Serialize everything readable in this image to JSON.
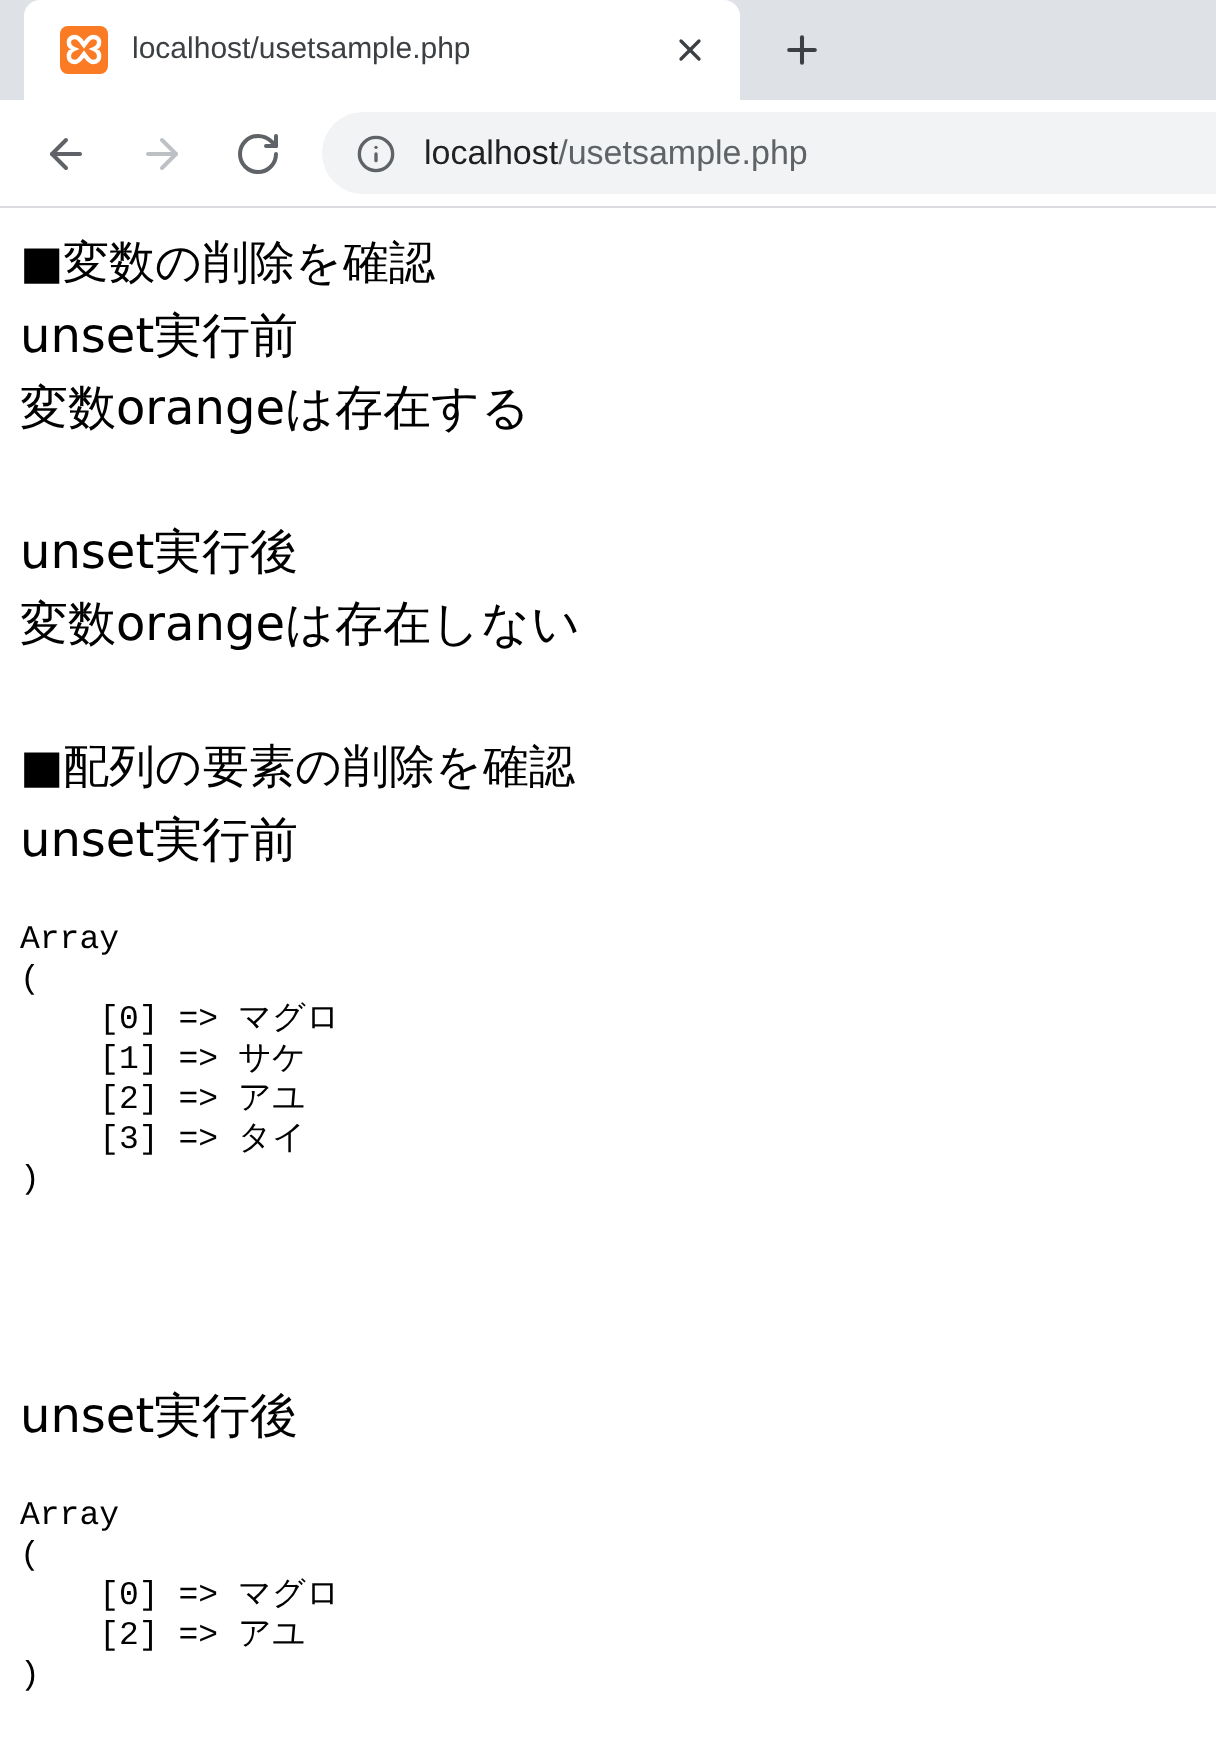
{
  "browser": {
    "tabs": [
      {
        "title": "localhost/usetsample.php",
        "selected": true
      }
    ],
    "nav_buttons": [
      {
        "kind": "back",
        "disabled": false
      },
      {
        "kind": "forward",
        "disabled": true
      },
      {
        "kind": "reload",
        "disabled": false
      }
    ],
    "address_bar": {
      "host": "localhost",
      "path": "/usetsample.php"
    }
  },
  "page": {
    "sections": [
      {
        "heading": "■変数の削除を確認",
        "blocks": [
          {
            "kind": "text",
            "lines": [
              "unset実行前",
              "変数orangeは存在する"
            ]
          },
          {
            "kind": "text",
            "lines": [
              "unset実行後",
              "変数orangeは存在しない"
            ]
          }
        ]
      },
      {
        "heading": "■配列の要素の削除を確認",
        "blocks": [
          {
            "kind": "dump",
            "caption": "unset実行前",
            "lines": [
              "Array",
              "(",
              "    [0] => マグロ",
              "    [1] => サケ",
              "    [2] => アユ",
              "    [3] => タイ",
              ")"
            ]
          },
          {
            "kind": "dump",
            "caption": "unset実行後",
            "lines": [
              "Array",
              "(",
              "    [0] => マグロ",
              "    [2] => アユ",
              ")"
            ]
          }
        ]
      }
    ]
  }
}
